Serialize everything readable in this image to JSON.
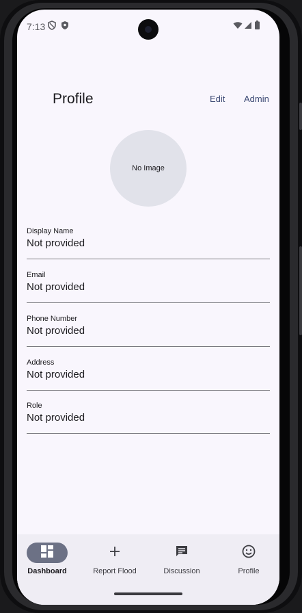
{
  "status_bar": {
    "time": "7:13"
  },
  "app_bar": {
    "title": "Profile",
    "edit_label": "Edit",
    "admin_label": "Admin"
  },
  "avatar": {
    "placeholder_text": "No Image"
  },
  "fields": [
    {
      "label": "Display Name",
      "value": "Not provided"
    },
    {
      "label": "Email",
      "value": "Not provided"
    },
    {
      "label": "Phone Number",
      "value": "Not provided"
    },
    {
      "label": "Address",
      "value": "Not provided"
    },
    {
      "label": "Role",
      "value": "Not provided"
    }
  ],
  "nav": {
    "items": [
      {
        "label": "Dashboard",
        "icon": "dashboard-icon",
        "active": true
      },
      {
        "label": "Report Flood",
        "icon": "plus-icon",
        "active": false
      },
      {
        "label": "Discussion",
        "icon": "chat-icon",
        "active": false
      },
      {
        "label": "Profile",
        "icon": "smiley-icon",
        "active": false
      }
    ]
  },
  "colors": {
    "background": "#f9f6fd",
    "accent_text": "#3d4a75",
    "active_pill": "#6c7185",
    "nav_background": "#efedf4"
  }
}
